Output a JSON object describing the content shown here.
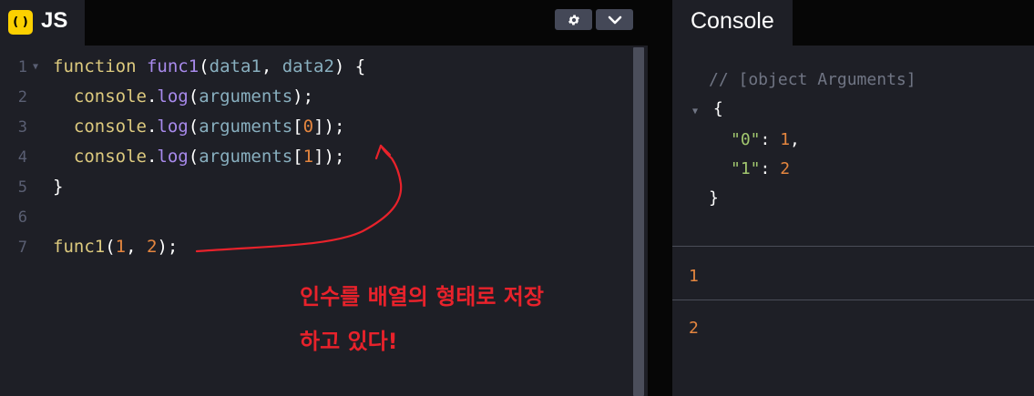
{
  "js_panel": {
    "icon_glyph": "( )",
    "title": "JS",
    "settings_icon": "gear-icon",
    "collapse_icon": "chevron-down-icon",
    "line_numbers": [
      "1",
      "2",
      "3",
      "4",
      "5",
      "6",
      "7"
    ],
    "code": {
      "l1": {
        "kw": "function",
        "fn": "func1",
        "open": "(",
        "p1": "data1",
        "comma": ", ",
        "p2": "data2",
        "close": ") {"
      },
      "l2": {
        "obj": "console",
        "dot": ".",
        "method": "log",
        "open": "(",
        "arg": "arguments",
        "close": ");"
      },
      "l3": {
        "obj": "console",
        "dot": ".",
        "method": "log",
        "open": "(",
        "arg": "arguments",
        "lb": "[",
        "idx": "0",
        "rb": "]",
        "close": ");"
      },
      "l4": {
        "obj": "console",
        "dot": ".",
        "method": "log",
        "open": "(",
        "arg": "arguments",
        "lb": "[",
        "idx": "1",
        "rb": "]",
        "close": ");"
      },
      "l5": {
        "brace": "}"
      },
      "l7": {
        "fn": "func1",
        "open": "(",
        "a1": "1",
        "comma": ", ",
        "a2": "2",
        "close": ");"
      }
    },
    "annotation": {
      "line1": "인수를 배열의 형태로 저장",
      "line2": "하고 있다!",
      "color": "#e8222b"
    }
  },
  "console_panel": {
    "title": "Console",
    "entries": {
      "comment": "// [object Arguments]",
      "obj_open": "{",
      "key0": "\"0\"",
      "val0": "1",
      "key1": "\"1\"",
      "val1": "2",
      "colon": ": ",
      "comma": ",",
      "obj_close": "}",
      "log2": "1",
      "log3": "2"
    }
  },
  "colors": {
    "editor_bg": "#1e1f26",
    "header_bg": "#060606",
    "js_badge": "#fcd000",
    "keyword": "#ddca7e",
    "function_name": "#a88aec",
    "number": "#e5863f",
    "string": "#a2c76f"
  }
}
